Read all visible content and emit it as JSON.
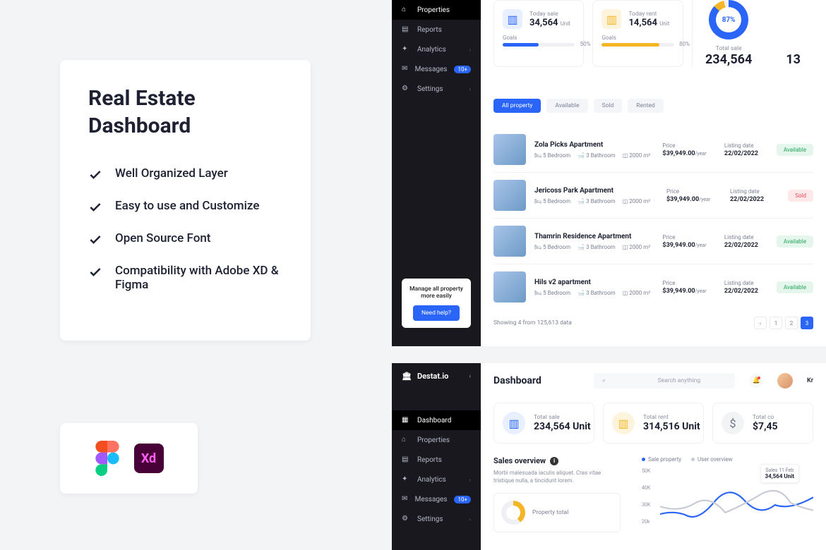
{
  "promo": {
    "title_line1": "Real Estate",
    "title_line2": "Dashboard",
    "features": [
      "Well Organized Layer",
      "Easy to use and Customize",
      "Open Source Font",
      "Compatibility with Adobe XD & Figma"
    ],
    "xd_label": "Xd"
  },
  "sidebar": {
    "brand": "Destat.io",
    "items": [
      {
        "label": "Dashboard"
      },
      {
        "label": "Properties"
      },
      {
        "label": "Reports"
      },
      {
        "label": "Analytics"
      },
      {
        "label": "Messages",
        "badge": "10+"
      },
      {
        "label": "Settings"
      }
    ],
    "help_text": "Manage all property more easily",
    "help_button": "Need help?"
  },
  "top": {
    "today_sale_label": "Today sale",
    "today_sale_value": "34,564",
    "today_rent_label": "Today rent",
    "today_rent_value": "14,564",
    "unit": "Unit",
    "goals_label": "Goals",
    "sale_goals_pct": "50%",
    "rent_goals_pct": "80%",
    "donut_pct": "87%",
    "total_sale_label": "Total sale",
    "total_sale_value": "234,564",
    "side_value": "13",
    "filters": [
      "All property",
      "Available",
      "Sold",
      "Rented"
    ],
    "columns": {
      "price": "Price",
      "date": "Listing date"
    },
    "feats": {
      "bed": "5 Bedroom",
      "bath": "3 Bathroom",
      "area": "2000 m²"
    },
    "props": [
      {
        "name": "Zola Picks Apartment",
        "price": "$39,949.00",
        "suffix": "/year",
        "date": "22/02/2022",
        "status": "Available",
        "statusClass": "avail"
      },
      {
        "name": "Jericoss Park Apartment",
        "price": "$39,949.00",
        "suffix": "/year",
        "date": "22/02/2022",
        "status": "Sold",
        "statusClass": "sold"
      },
      {
        "name": "Thamrin Residence Apartment",
        "price": "$39,949.00",
        "suffix": "/year",
        "date": "22/02/2022",
        "status": "Available",
        "statusClass": "avail"
      },
      {
        "name": "Hils v2 apartment",
        "price": "$39,949.00",
        "suffix": "/year",
        "date": "22/02/2022",
        "status": "Available",
        "statusClass": "avail"
      }
    ],
    "showing": "Showing 4 from 125,613 data",
    "pages": [
      "1",
      "2",
      "3"
    ]
  },
  "bot": {
    "title": "Dashboard",
    "search_placeholder": "Search anything",
    "user_name": "Kr",
    "cards": [
      {
        "label": "Total sale",
        "value": "234,564 Unit",
        "icon": "blue"
      },
      {
        "label": "Total rent",
        "value": "314,516 Unit",
        "icon": "yellow"
      },
      {
        "label": "Total co",
        "value": "$7,45",
        "icon": "gray"
      }
    ],
    "sales_title": "Sales overview",
    "sales_desc": "Morbi malesuada iaculis aliquet. Cras vitae tristique nulla, a tincidunt lorem.",
    "property_total": "Property total",
    "legend": [
      {
        "label": "Sale property",
        "color": "#2a65f8"
      },
      {
        "label": "User overview",
        "color": "#c8cbd5"
      }
    ],
    "tooltip_date": "Sales 11 Feb",
    "tooltip_value": "34,564 Unit"
  },
  "chart_data": {
    "type": "line",
    "y_ticks": [
      "50K",
      "40K",
      "30K",
      "20k"
    ],
    "ylim": [
      20000,
      50000
    ],
    "series": [
      {
        "name": "Sale property",
        "color": "#2a65f8",
        "values": [
          24000,
          26000,
          23000,
          30000,
          42000,
          32000,
          28000,
          34564
        ]
      },
      {
        "name": "User overview",
        "color": "#c8cbd5",
        "values": [
          28000,
          25000,
          30000,
          24000,
          27000,
          35000,
          30000,
          26000
        ]
      }
    ],
    "tooltip": {
      "label": "Sales 11 Feb",
      "value": "34,564 Unit"
    }
  }
}
